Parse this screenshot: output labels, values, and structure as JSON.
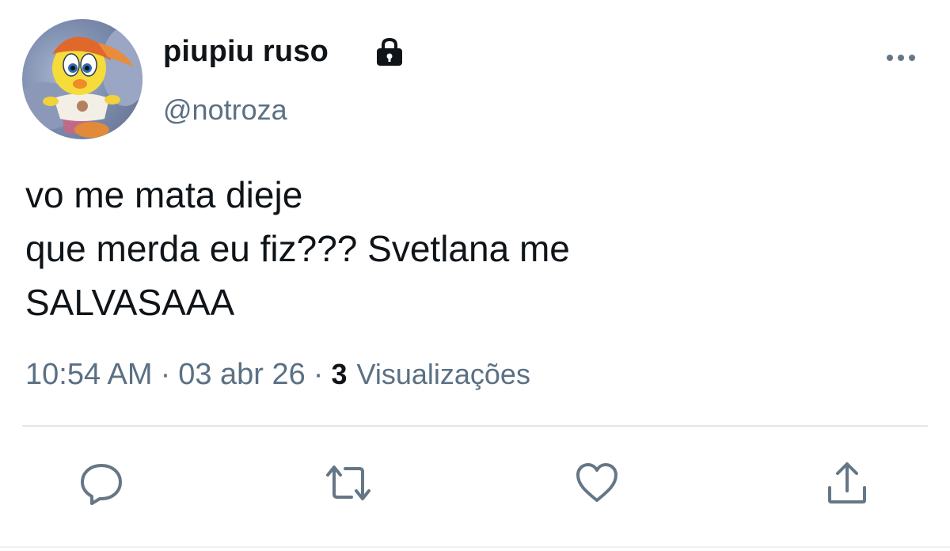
{
  "user": {
    "display_name": "piupiu ruso",
    "handle": "@notroza",
    "avatar_icon": "tweety-bird-avatar",
    "protected_icon": "lock-icon"
  },
  "tweet": {
    "lines": [
      "vo me mata dieje",
      "que merda eu fiz??? Svetlana me",
      "SALVASAAA"
    ],
    "time": "10:54 AM",
    "separator": "·",
    "date": "03 abr 26",
    "views_count": "3",
    "views_label": "Visualizações"
  },
  "actions": {
    "reply_icon": "reply-icon",
    "retweet_icon": "retweet-icon",
    "like_icon": "heart-icon",
    "share_icon": "share-icon",
    "more_icon": "more-icon"
  },
  "colors": {
    "text": "#0f1419",
    "secondary": "#5b7083",
    "divider": "#e1e8ed",
    "icon": "#657786"
  }
}
